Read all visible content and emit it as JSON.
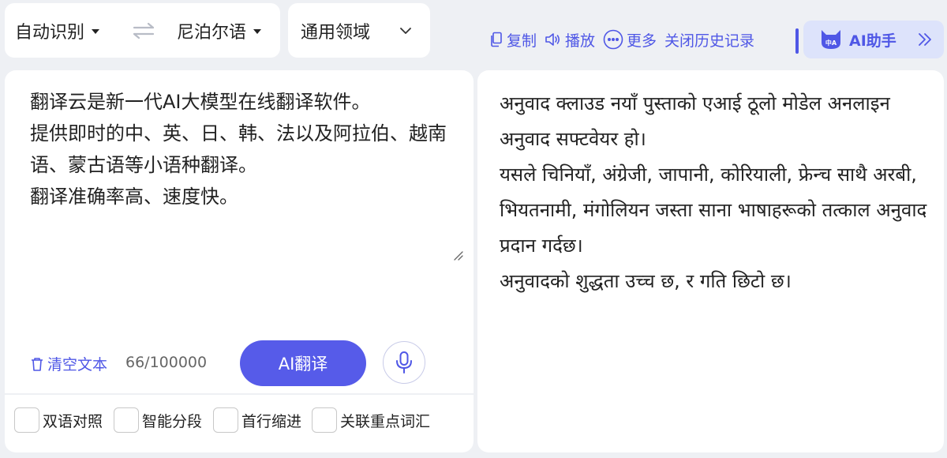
{
  "language_bar": {
    "source_language": "自动识别",
    "target_language": "尼泊尔语",
    "domain": "通用领域"
  },
  "toolbar": {
    "copy_label": "复制",
    "play_label": "播放",
    "more_label": "更多",
    "history_label": "关闭历史记录",
    "ai_assistant_label": "AI助手",
    "ai_badge_text": "中A"
  },
  "source_panel": {
    "text": "翻译云是新一代AI大模型在线翻译软件。\n提供即时的中、英、日、韩、法以及阿拉伯、越南语、蒙古语等小语种翻译。\n翻译准确率高、速度快。",
    "clear_label": "清空文本",
    "char_count": "66/100000",
    "translate_button": "AI翻译"
  },
  "options": [
    {
      "label": "双语对照",
      "checked": false
    },
    {
      "label": "智能分段",
      "checked": false
    },
    {
      "label": "首行缩进",
      "checked": false
    },
    {
      "label": "关联重点词汇",
      "checked": false
    }
  ],
  "target_panel": {
    "text": "अनुवाद क्लाउड नयाँ पुस्ताको एआई ठूलो मोडेल अनलाइन अनुवाद सफ्टवेयर हो।\nयसले चिनियाँ, अंग्रेजी, जापानी, कोरियाली, फ्रेन्च साथै अरबी, भियतनामी, मंगोलियन जस्ता साना भाषाहरूको तत्काल अनुवाद प्रदान गर्दछ।\nअनुवादको शुद्धता उच्च छ, र गति छिटो छ।"
  },
  "colors": {
    "accent": "#4f57e6",
    "translate_button": "#565be9",
    "ai_assistant_bg": "#dde3fb",
    "page_bg": "#eef0f4"
  }
}
